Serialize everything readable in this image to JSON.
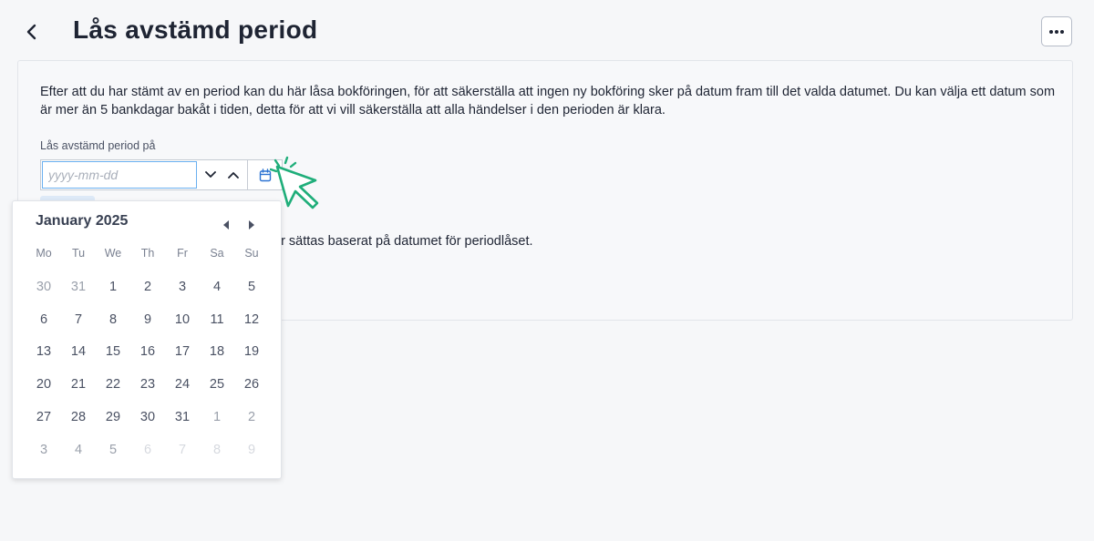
{
  "header": {
    "title": "Lås avstämd period",
    "back_icon": "chevron-left-icon",
    "more_icon": "more-horizontal-icon"
  },
  "card": {
    "description": "Efter att du har stämt av en period kan du här låsa bokföringen, för att säkerställa att ingen ny bokföring sker på datum fram till det valda datumet. Du kan välja ett datum som är mer än 5 bankdagar bakåt i tiden, detta för att vi vill säkerställa att alla händelser i den perioden är klara.",
    "field_label": "Lås avstämd period på",
    "date_placeholder": "yyyy-mm-dd",
    "date_value": "",
    "info_text_partial": "er sättas baserat på datumet för periodlåset."
  },
  "calendar": {
    "month_label": "January 2025",
    "weekdays": [
      "Mo",
      "Tu",
      "We",
      "Th",
      "Fr",
      "Sa",
      "Su"
    ],
    "days": [
      {
        "label": "30",
        "state": "other"
      },
      {
        "label": "31",
        "state": "other"
      },
      {
        "label": "1",
        "state": "current"
      },
      {
        "label": "2",
        "state": "current"
      },
      {
        "label": "3",
        "state": "current"
      },
      {
        "label": "4",
        "state": "current"
      },
      {
        "label": "5",
        "state": "current"
      },
      {
        "label": "6",
        "state": "current"
      },
      {
        "label": "7",
        "state": "current"
      },
      {
        "label": "8",
        "state": "current"
      },
      {
        "label": "9",
        "state": "current"
      },
      {
        "label": "10",
        "state": "current"
      },
      {
        "label": "11",
        "state": "current"
      },
      {
        "label": "12",
        "state": "current"
      },
      {
        "label": "13",
        "state": "current"
      },
      {
        "label": "14",
        "state": "current"
      },
      {
        "label": "15",
        "state": "current"
      },
      {
        "label": "16",
        "state": "current"
      },
      {
        "label": "17",
        "state": "current"
      },
      {
        "label": "18",
        "state": "current"
      },
      {
        "label": "19",
        "state": "current"
      },
      {
        "label": "20",
        "state": "current"
      },
      {
        "label": "21",
        "state": "current"
      },
      {
        "label": "22",
        "state": "current"
      },
      {
        "label": "23",
        "state": "current"
      },
      {
        "label": "24",
        "state": "current"
      },
      {
        "label": "25",
        "state": "current"
      },
      {
        "label": "26",
        "state": "current"
      },
      {
        "label": "27",
        "state": "current"
      },
      {
        "label": "28",
        "state": "current"
      },
      {
        "label": "29",
        "state": "current"
      },
      {
        "label": "30",
        "state": "current"
      },
      {
        "label": "31",
        "state": "current"
      },
      {
        "label": "1",
        "state": "other"
      },
      {
        "label": "2",
        "state": "other"
      },
      {
        "label": "3",
        "state": "other"
      },
      {
        "label": "4",
        "state": "other"
      },
      {
        "label": "5",
        "state": "other"
      },
      {
        "label": "6",
        "state": "disabled"
      },
      {
        "label": "7",
        "state": "disabled"
      },
      {
        "label": "8",
        "state": "disabled"
      },
      {
        "label": "9",
        "state": "disabled"
      }
    ]
  },
  "colors": {
    "accent": "#2c73d2",
    "focus_border": "#6ab0f0",
    "cursor_highlight": "#1fae7a"
  }
}
